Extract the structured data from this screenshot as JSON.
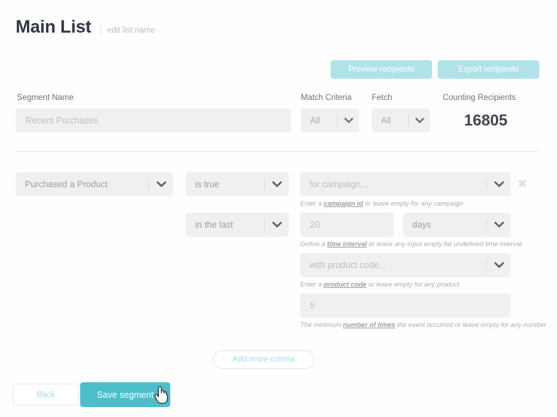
{
  "header": {
    "title": "Main List",
    "separator": "|",
    "edit_link": "edit list name"
  },
  "top_actions": {
    "preview_label": "Preview recipients",
    "export_label": "Export recipients"
  },
  "form": {
    "segment_name_label": "Segment Name",
    "segment_name_placeholder": "Recent Purchases",
    "segment_name_value": "",
    "match_criteria_label": "Match Criteria",
    "match_criteria_value": "All",
    "fetch_label": "Fetch",
    "fetch_value": "All",
    "counting_label": "Counting Recipients",
    "counting_value": "16805"
  },
  "criteria": {
    "attribute_value": "Purchased a Product",
    "operator_value": "is true",
    "campaign_placeholder": "for campaign...",
    "campaign_value": "",
    "campaign_hint_before": "Enter a ",
    "campaign_hint_strong": "campaign id",
    "campaign_hint_after": " or leave empty for any campaign",
    "when_value": "in the last",
    "amount_placeholder": "20",
    "amount_value": "",
    "unit_value": "days",
    "interval_hint_before": "Define a ",
    "interval_hint_strong": "time interval",
    "interval_hint_after": " or leave any input empty for undefined time interval",
    "product_placeholder": "with product code...",
    "product_value": "",
    "product_hint_before": "Enter a ",
    "product_hint_strong": "product code",
    "product_hint_after": " or leave empty for any product",
    "times_placeholder": "5",
    "times_value": "",
    "times_hint_before": "The minimum ",
    "times_hint_strong": "number of times",
    "times_hint_after": " the event occurred or leave empty for any number",
    "remove_icon": "close-x-icon"
  },
  "footer": {
    "add_more_label": "Add more criteria",
    "back_label": "Back",
    "save_label": "Save segment"
  },
  "colors": {
    "teal_primary": "#4cbfcb",
    "cyan_light": "#b0e2e9",
    "input_bg": "#f0f0f0",
    "title_navy": "#2f3646",
    "link_cyan": "#a8dde6"
  }
}
